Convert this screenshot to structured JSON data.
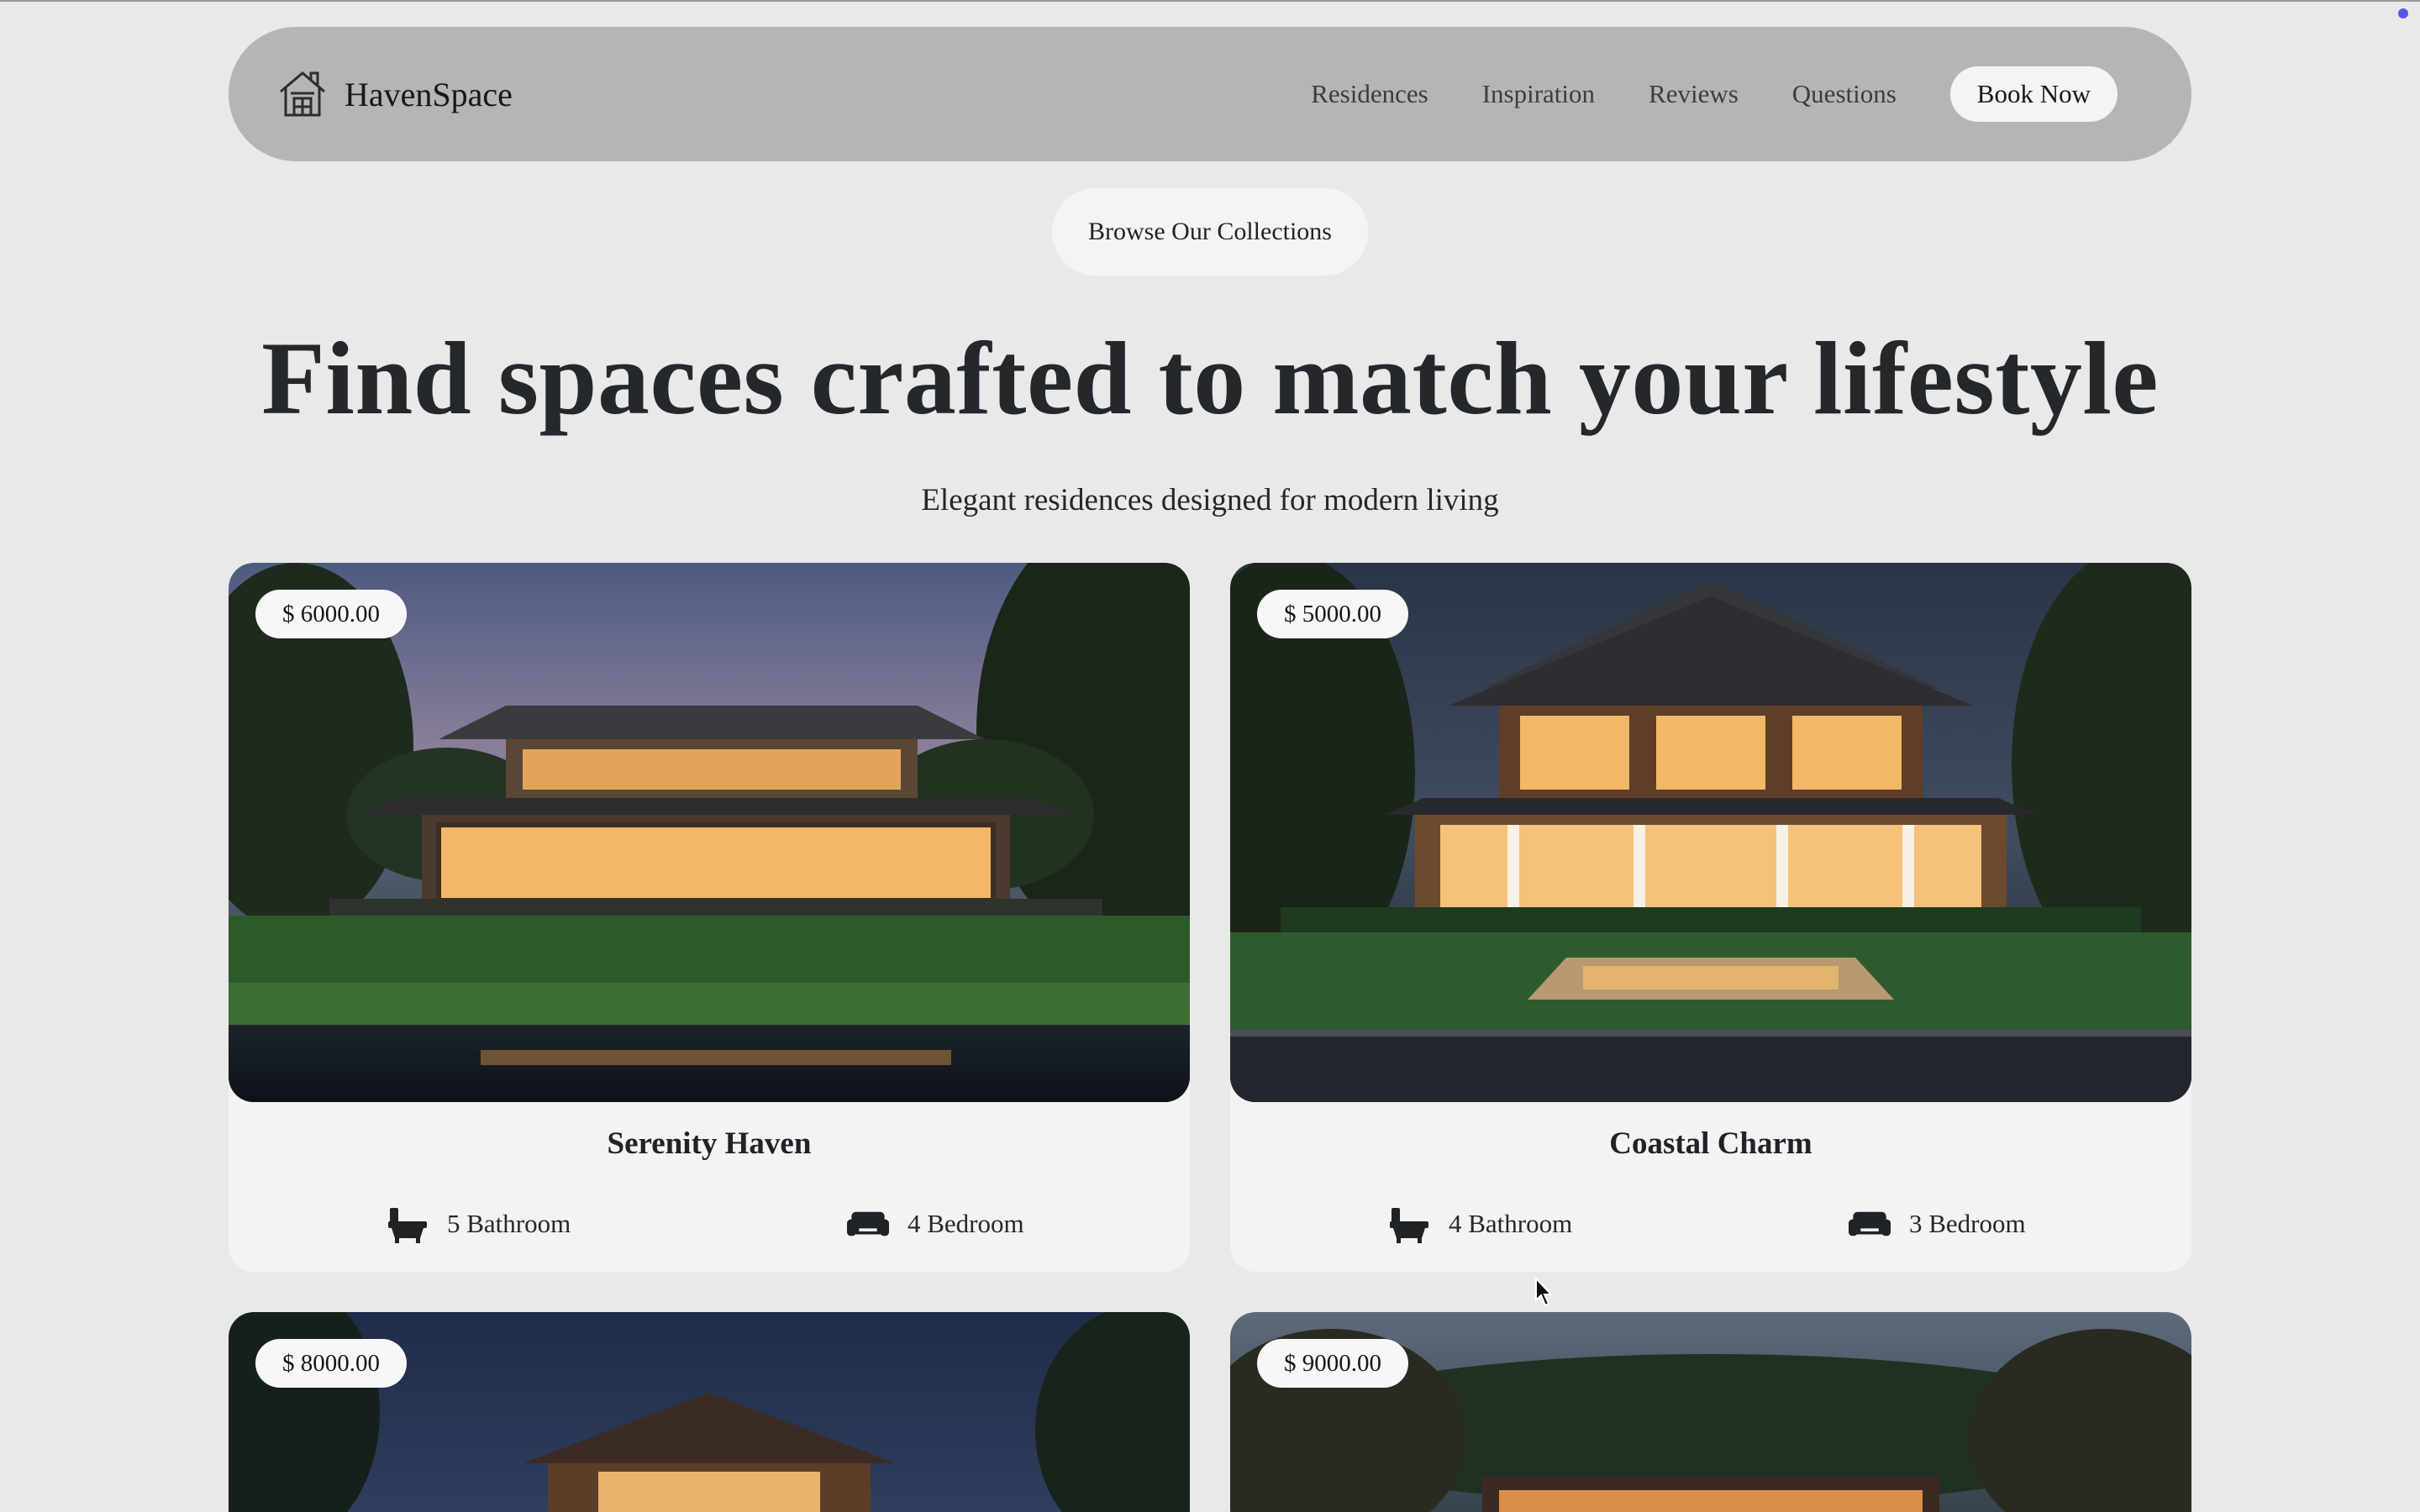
{
  "brand": {
    "name": "HavenSpace",
    "icon": "house-icon"
  },
  "nav": {
    "links": [
      "Residences",
      "Inspiration",
      "Reviews",
      "Questions"
    ],
    "cta": "Book Now"
  },
  "hero": {
    "browse_label": "Browse Our Collections",
    "title": "Find spaces crafted to match your lifestyle",
    "subtitle": "Elegant residences designed for modern living"
  },
  "listings": [
    {
      "price": "$ 6000.00",
      "name": "Serenity Haven",
      "bathrooms": "5 Bathroom",
      "bedrooms": "4 Bedroom"
    },
    {
      "price": "$ 5000.00",
      "name": "Coastal Charm",
      "bathrooms": "4 Bathroom",
      "bedrooms": "3 Bedroom"
    },
    {
      "price": "$ 8000.00"
    },
    {
      "price": "$ 9000.00"
    }
  ],
  "icons": {
    "bath": "bathtub-icon",
    "bed": "sofa-bed-icon"
  },
  "colors": {
    "background": "#e9e9e9",
    "nav_bg": "#b5b5b5",
    "pill_bg": "#f4f4f4",
    "card_bg": "#f3f3f3"
  }
}
